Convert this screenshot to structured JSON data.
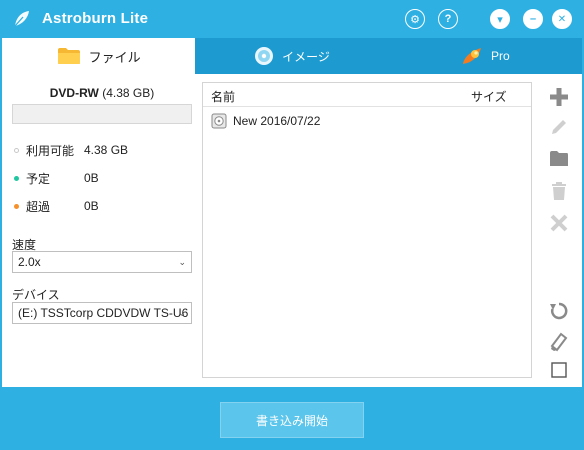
{
  "app": {
    "title": "Astroburn Lite"
  },
  "titlebar": {
    "buttons": [
      {
        "name": "settings",
        "icon": "gear-icon",
        "glyph": "⚙"
      },
      {
        "name": "help",
        "icon": "help-icon",
        "glyph": "?"
      },
      {
        "name": "menu",
        "icon": "chevron-down-icon",
        "glyph": "▾"
      },
      {
        "name": "minimize",
        "icon": "minimize-icon",
        "glyph": "–"
      },
      {
        "name": "close",
        "icon": "close-icon",
        "glyph": "✕"
      }
    ]
  },
  "tabs": [
    {
      "label": "ファイル",
      "icon": "folder-icon",
      "active": true
    },
    {
      "label": "イメージ",
      "icon": "disc-icon",
      "active": false
    },
    {
      "label": "Pro",
      "icon": "flame-icon",
      "active": false
    }
  ],
  "disc": {
    "type": "DVD-RW",
    "size": "(4.38 GB)"
  },
  "capacity": {
    "available": {
      "label": "利用可能",
      "value": "4.38 GB",
      "color": "#ffffff"
    },
    "planned": {
      "label": "予定",
      "value": "0B",
      "color": "#1fc7a0"
    },
    "exceeded": {
      "label": "超過",
      "value": "0B",
      "color": "#f5902a"
    }
  },
  "speed": {
    "label": "速度",
    "value": "2.0x"
  },
  "device": {
    "label": "デバイス",
    "value": "(E:) TSSTcorp CDDVDW TS-U6"
  },
  "filelist": {
    "columns": [
      "名前",
      "サイズ"
    ],
    "rows": [
      {
        "name": "New 2016/07/22",
        "size": "",
        "icon": "disc-image-icon"
      }
    ]
  },
  "toolbar": [
    {
      "name": "add",
      "icon": "add-icon",
      "enabled": true
    },
    {
      "name": "edit",
      "icon": "pencil-icon",
      "enabled": false
    },
    {
      "name": "new-folder",
      "icon": "folder-icon",
      "enabled": true
    },
    {
      "name": "delete",
      "icon": "trash-icon",
      "enabled": false
    },
    {
      "name": "remove",
      "icon": "x-icon",
      "enabled": false
    },
    {
      "name": "refresh",
      "icon": "refresh-icon",
      "enabled": true
    },
    {
      "name": "erase",
      "icon": "eraser-icon",
      "enabled": true
    },
    {
      "name": "select",
      "icon": "checkbox-icon",
      "enabled": true
    }
  ],
  "burn": {
    "label": "書き込み開始"
  },
  "colors": {
    "accent": "#2fb0e3",
    "tabbar": "#1d9bd1",
    "icon": "#8a8a8a",
    "icon_disabled": "#cfcfcf"
  }
}
